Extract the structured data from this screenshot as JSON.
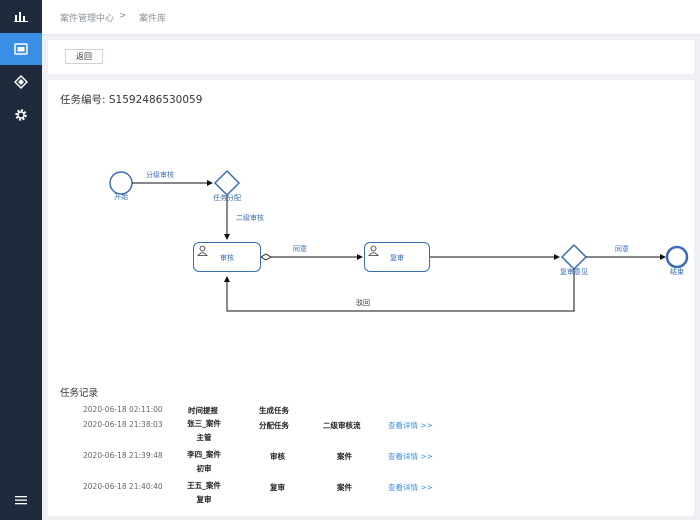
{
  "breadcrumb": {
    "items": [
      "案件管理中心",
      "案件库"
    ],
    "separator": ">"
  },
  "toolbar": {
    "back_label": "返回"
  },
  "task": {
    "label": "任务编号:",
    "number": "S1592486530059"
  },
  "flow": {
    "start_label": "开始",
    "gateway1_label": "任务分配",
    "edge_start_gw1": "分级审核",
    "edge_gw1_task1": "二级审核",
    "task1_label": "审核",
    "edge_task1_task2": "同意",
    "task2_label": "复审",
    "gateway2_label": "复审意见",
    "edge_gw2_end": "同意",
    "edge_reject": "驳回",
    "end_label": "结束"
  },
  "records": {
    "title": "任务记录",
    "link_label": "查看详情 >>",
    "rows": [
      {
        "time": "2020-06-18 02:11:00",
        "user": "时间提报",
        "action": "生成任务",
        "note": "",
        "link": false
      },
      {
        "time": "2020-06-18 21:38:03",
        "user": "张三_案件主管",
        "action": "分配任务",
        "note": "二级审核流",
        "link": true
      },
      {
        "time": "2020-06-18 21:39:48",
        "user": "李四_案件初审",
        "action": "审核",
        "note": "案件",
        "link": true
      },
      {
        "time": "2020-06-18 21:40:40",
        "user": "王五_案件复审",
        "action": "复审",
        "note": "案件",
        "link": true
      }
    ]
  },
  "colors": {
    "sidebar": "#1f2a3c",
    "active": "#3a8ee6",
    "flow": "#3a6db5"
  },
  "icons": [
    "chart-icon",
    "window-icon",
    "diamond-icon",
    "gear-icon",
    "menu-icon"
  ]
}
